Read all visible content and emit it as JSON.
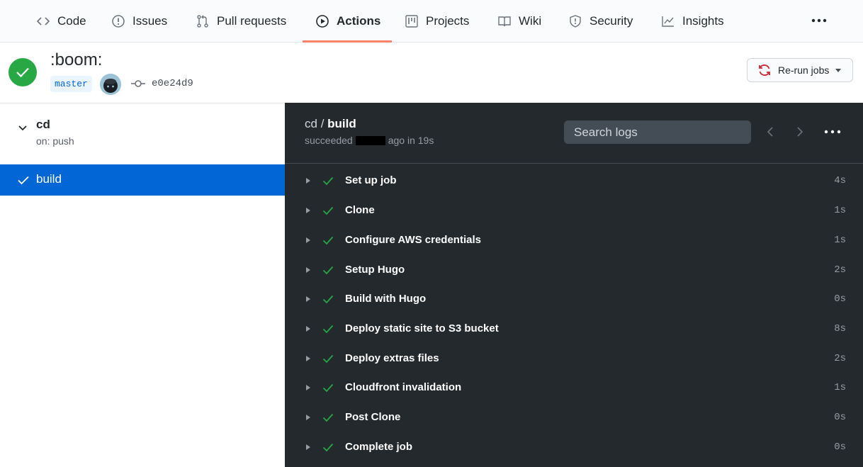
{
  "nav": {
    "tabs": [
      {
        "label": "Code",
        "icon": "code-icon"
      },
      {
        "label": "Issues",
        "icon": "issue-opened-icon"
      },
      {
        "label": "Pull requests",
        "icon": "git-pull-request-icon"
      },
      {
        "label": "Actions",
        "icon": "play-icon",
        "active": true
      },
      {
        "label": "Projects",
        "icon": "project-icon"
      },
      {
        "label": "Wiki",
        "icon": "book-icon"
      },
      {
        "label": "Security",
        "icon": "shield-icon"
      },
      {
        "label": "Insights",
        "icon": "graph-icon"
      }
    ],
    "more_icon": "kebab-horizontal-icon"
  },
  "run": {
    "title": ":boom:",
    "branch": "master",
    "commit_sha": "e0e24d9",
    "status": "success",
    "rerun_label": "Re-run jobs"
  },
  "sidebar": {
    "workflow_name": "cd",
    "workflow_trigger": "on: push",
    "jobs": [
      {
        "label": "build",
        "selected": true
      }
    ]
  },
  "log": {
    "breadcrumb_workflow": "cd",
    "breadcrumb_sep": " / ",
    "breadcrumb_job": "build",
    "meta_prefix": "succeeded",
    "meta_suffix": "ago in 19s",
    "search_placeholder": "Search logs",
    "steps": [
      {
        "name": "Set up job",
        "duration": "4s"
      },
      {
        "name": "Clone",
        "duration": "1s"
      },
      {
        "name": "Configure AWS credentials",
        "duration": "1s"
      },
      {
        "name": "Setup Hugo",
        "duration": "2s"
      },
      {
        "name": "Build with Hugo",
        "duration": "0s"
      },
      {
        "name": "Deploy static site to S3 bucket",
        "duration": "8s"
      },
      {
        "name": "Deploy extras files",
        "duration": "2s"
      },
      {
        "name": "Cloudfront invalidation",
        "duration": "1s"
      },
      {
        "name": "Post Clone",
        "duration": "0s"
      },
      {
        "name": "Complete job",
        "duration": "0s"
      }
    ]
  },
  "colors": {
    "success": "#28a745",
    "selected_job_bg": "#0366d6",
    "log_bg": "#24292e",
    "tab_underline": "#f9826c",
    "rerun_icon": "#cb2431"
  }
}
